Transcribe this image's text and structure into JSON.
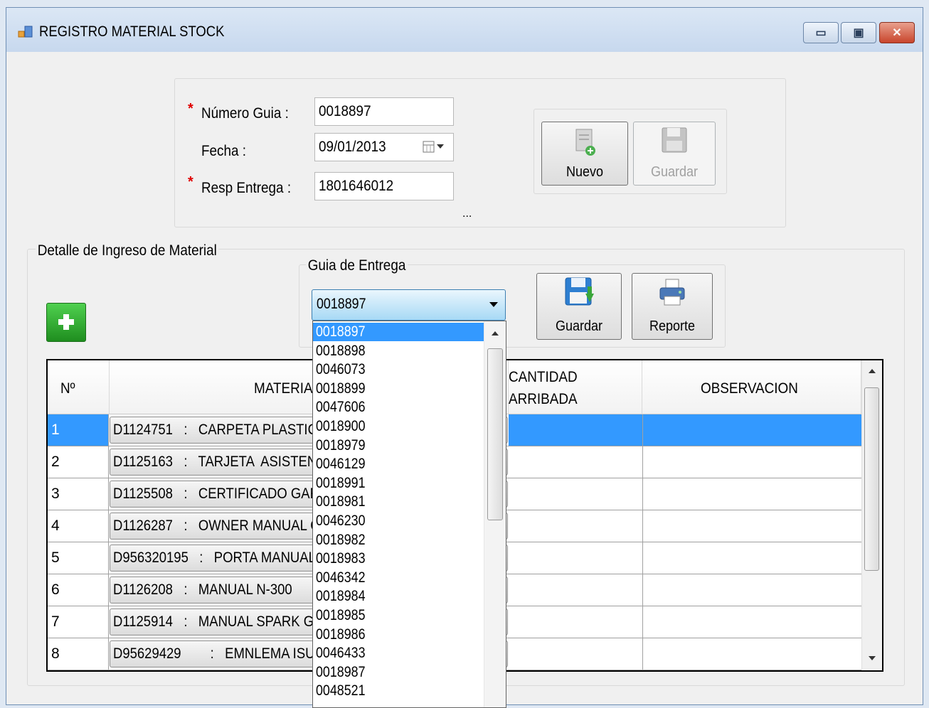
{
  "window": {
    "title": "REGISTRO MATERIAL STOCK",
    "controls": {
      "minimize": "▭",
      "maximize": "▣",
      "close": "✕"
    }
  },
  "header_form": {
    "numero_guia": {
      "label": "Número Guia :",
      "value": "0018897",
      "required": true
    },
    "fecha": {
      "label": "Fecha :",
      "value": "09/01/2013"
    },
    "resp_entrega": {
      "label": "Resp Entrega :",
      "value": "1801646012",
      "required": true
    },
    "ellipsis": "...",
    "buttons": {
      "nuevo": "Nuevo",
      "guardar": "Guardar"
    }
  },
  "detalle": {
    "group_title": "Detalle de Ingreso de Material",
    "guia_group_title": "Guia de Entrega",
    "guia_selected": "0018897",
    "buttons": {
      "guardar": "Guardar",
      "reporte": "Reporte"
    }
  },
  "grid": {
    "columns": [
      "Nº",
      "MATERIAL",
      "CANTIDAD ARRIBADA",
      "OBSERVACION"
    ],
    "col_cantidad_lines": [
      "CANTIDAD",
      "ARRIBADA"
    ],
    "col_material_visible": "MATERIA",
    "rows": [
      {
        "n": "1",
        "material": "D1124751   :   CARPETA PLASTIC"
      },
      {
        "n": "2",
        "material": "D1125163   :   TARJETA  ASISTEN"
      },
      {
        "n": "3",
        "material": "D1125508   :   CERTIFICADO GAR"
      },
      {
        "n": "4",
        "material": "D1126287   :   OWNER MANUAL C"
      },
      {
        "n": "5",
        "material": "D956320195   :   PORTA MANUAL"
      },
      {
        "n": "6",
        "material": "D1126208   :   MANUAL N-300"
      },
      {
        "n": "7",
        "material": "D1125914   :   MANUAL SPARK G"
      },
      {
        "n": "8",
        "material": "D95629429        :   EMNLEMA ISU"
      }
    ],
    "selected_row": 1
  },
  "dropdown_options": [
    "0018897",
    "0018898",
    "0046073",
    "0018899",
    "0047606",
    "0018900",
    "0018979",
    "0046129",
    "0018991",
    "0018981",
    "0046230",
    "0018982",
    "0018983",
    "0046342",
    "0018984",
    "0018985",
    "0018986",
    "0046433",
    "0018987",
    "0048521"
  ],
  "colors": {
    "selection": "#3399ff",
    "required": "#e00000",
    "add_button": "#2a9a2a"
  }
}
